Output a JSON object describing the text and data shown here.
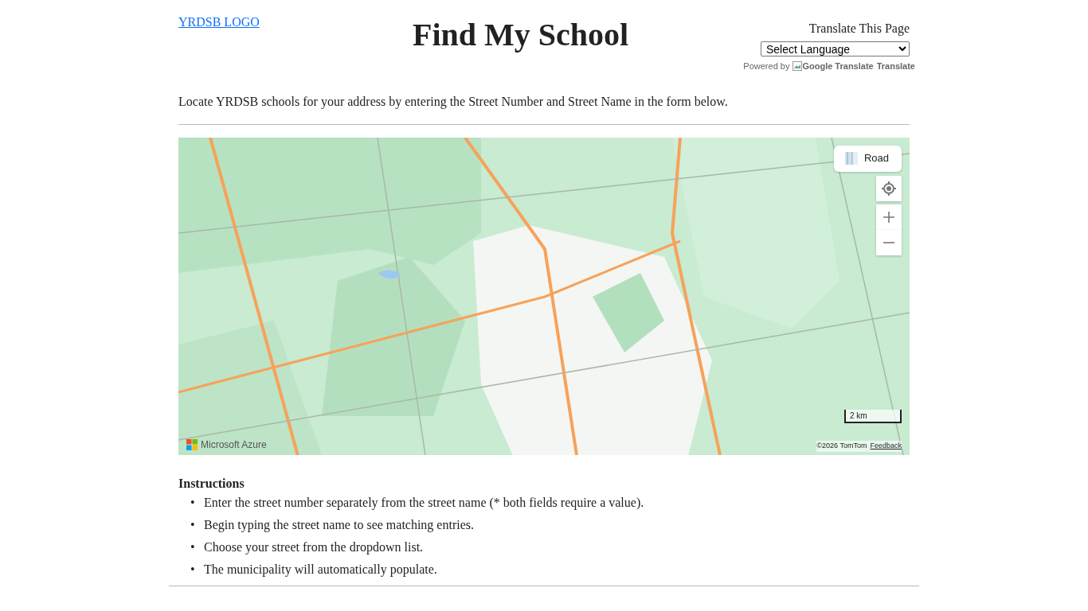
{
  "header": {
    "logo_alt": "YRDSB LOGO",
    "title": "Find My School",
    "translate": {
      "label": "Translate This Page",
      "select": "Select Language",
      "powered_by": "Powered by",
      "google_alt": "Google Translate",
      "brand": "Translate"
    }
  },
  "intro": "Locate YRDSB schools for your address by entering the Street Number and Street Name in the form below.",
  "map": {
    "kind": "picture",
    "style_button": "Road",
    "scale": "2 km",
    "attribution": "©2026 TomTom",
    "feedback": "Feedback",
    "provider": "Microsoft Azure"
  },
  "instructions": {
    "heading": "Instructions",
    "bullet": "•",
    "items": [
      "Enter the street number separately from the street name (* both fields require a value).",
      "Begin typing the street name to see matching entries.",
      "Choose your street from the dropdown list.",
      "The municipality will automatically populate."
    ]
  }
}
